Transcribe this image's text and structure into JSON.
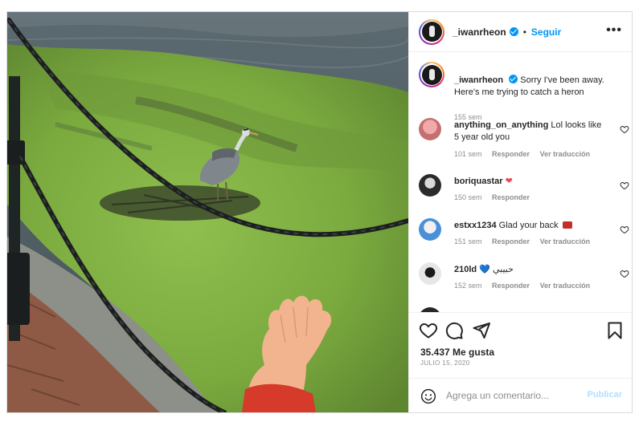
{
  "header": {
    "username": "_iwanrheon",
    "separator": "•",
    "follow_label": "Seguir",
    "more_label": "•••"
  },
  "caption": {
    "username": "_iwanrheon",
    "text": "Sorry I've been away. Here's me trying to catch a heron",
    "time": "155 sem"
  },
  "comments": [
    {
      "username": "anything_on_anything",
      "text": "Lol looks like 5 year old you",
      "time": "101 sem",
      "reply": "Responder",
      "translate": "Ver traducción"
    },
    {
      "username": "boriquastar",
      "text": "",
      "emoji": "❤",
      "time": "150 sem",
      "reply": "Responder",
      "translate": ""
    },
    {
      "username": "estxx1234",
      "text": "Glad your back",
      "emoji": "",
      "time": "151 sem",
      "reply": "Responder",
      "translate": "Ver traducción"
    },
    {
      "username": "210ld",
      "text": "حبيبي",
      "emoji": "💙",
      "time": "152 sem",
      "reply": "Responder",
      "translate": "Ver traducción"
    }
  ],
  "actions": {
    "likes": "35.437 Me gusta",
    "date": "JULIO 15, 2020"
  },
  "add_comment": {
    "placeholder": "Agrega un comentario...",
    "publish_label": "Publicar"
  },
  "colors": {
    "accent": "#0095f6",
    "heart": "#ed4956",
    "muted": "#8e8e8e"
  },
  "icons": {
    "header": [
      "verified-badge-icon",
      "more-options-icon"
    ],
    "actions": [
      "heart-icon",
      "comment-icon",
      "share-icon",
      "bookmark-icon"
    ],
    "composer": [
      "emoji-icon"
    ]
  }
}
